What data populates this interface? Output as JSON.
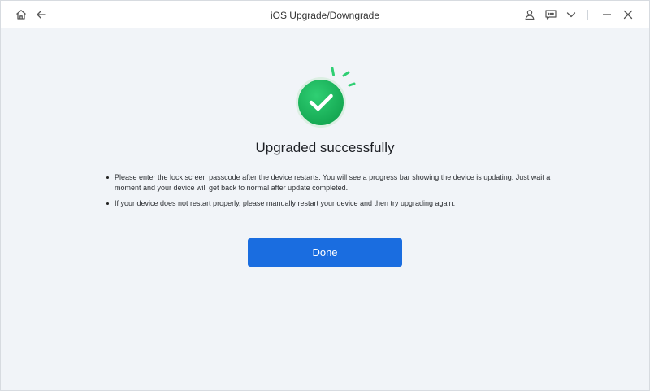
{
  "window": {
    "title": "iOS Upgrade/Downgrade"
  },
  "titlebar_icons": {
    "left": [
      "home-icon",
      "back-arrow-icon"
    ],
    "right": [
      "account-icon",
      "feedback-icon",
      "chevron-down-icon",
      "minimize-icon",
      "close-icon"
    ]
  },
  "main": {
    "heading": "Upgraded successfully",
    "notes": [
      "Please enter the lock screen passcode after the device restarts. You will see a progress bar showing the device is updating. Just wait a moment and your device will get back to normal after update completed.",
      "If your device does not restart properly, please manually restart your device and then try upgrading again."
    ],
    "done_label": "Done"
  },
  "colors": {
    "accent": "#1a6de0",
    "success": "#19b45c",
    "background": "#f1f4f8"
  }
}
